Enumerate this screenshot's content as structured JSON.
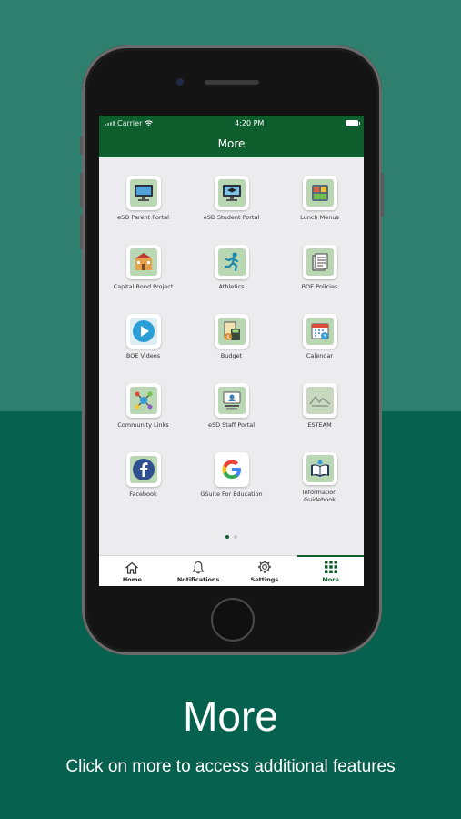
{
  "status": {
    "carrier": "Carrier",
    "time": "4:20 PM"
  },
  "nav": {
    "title": "More"
  },
  "tiles": [
    {
      "label": "eSD Parent Portal",
      "icon": "monitor-icon"
    },
    {
      "label": "eSD Student Portal",
      "icon": "graduation-monitor-icon"
    },
    {
      "label": "Lunch Menus",
      "icon": "food-tray-icon"
    },
    {
      "label": "Capital Bond Project",
      "icon": "school-building-icon"
    },
    {
      "label": "Athletics",
      "icon": "runner-icon"
    },
    {
      "label": "BOE Policies",
      "icon": "documents-icon"
    },
    {
      "label": "BOE Videos",
      "icon": "play-icon"
    },
    {
      "label": "Budget",
      "icon": "budget-calculator-icon"
    },
    {
      "label": "Calendar",
      "icon": "calendar-icon"
    },
    {
      "label": "Community Links",
      "icon": "network-globe-icon"
    },
    {
      "label": "eSD Staff Portal",
      "icon": "staff-portal-icon"
    },
    {
      "label": "ESTEAM",
      "icon": "esteam-logo-icon"
    },
    {
      "label": "Facebook",
      "icon": "facebook-icon"
    },
    {
      "label": "GSuite For Education",
      "icon": "google-icon"
    },
    {
      "label": "Information Guidebook",
      "icon": "guidebook-icon"
    }
  ],
  "tabs": [
    {
      "label": "Home",
      "icon": "home-icon"
    },
    {
      "label": "Notifications",
      "icon": "bell-icon"
    },
    {
      "label": "Settings",
      "icon": "gear-icon"
    },
    {
      "label": "More",
      "icon": "grid-icon"
    }
  ],
  "caption": {
    "title": "More",
    "subtitle": "Click on more to access additional features"
  },
  "colors": {
    "brand": "#0e5e2e",
    "background": "#06614f",
    "background_top": "#2f7f6f",
    "tile_fill": "#b9d7b3"
  }
}
